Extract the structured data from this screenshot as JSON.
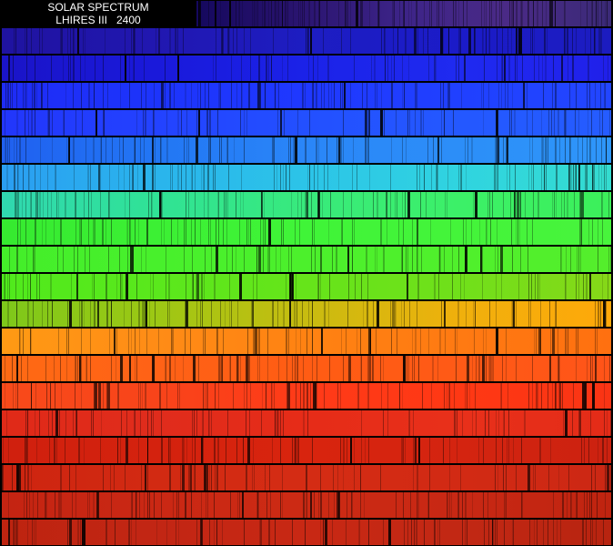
{
  "title": {
    "line1": "SOLAR SPECTRUM",
    "line2": "LHIRES III   2400"
  },
  "strips": [
    {
      "colors": [
        "#15085e",
        "#2a1470",
        "#3d2488",
        "#4a2a86",
        "#3b2a78"
      ]
    },
    {
      "colors": [
        "#1f13a0",
        "#2117b0",
        "#1d1dc2",
        "#1b1bc8",
        "#1c1cc0"
      ]
    },
    {
      "colors": [
        "#1a14c8",
        "#1a19da",
        "#1b22e8",
        "#1f2af0",
        "#2020ea"
      ]
    },
    {
      "colors": [
        "#1e2cf6",
        "#1d34fb",
        "#1f38ff",
        "#2040ff",
        "#2246ff"
      ]
    },
    {
      "colors": [
        "#2236fb",
        "#2342ff",
        "#2350ff",
        "#2458ff",
        "#255cff"
      ]
    },
    {
      "colors": [
        "#2060f0",
        "#2276f4",
        "#2a86f8",
        "#2c8ef8",
        "#2e96fa"
      ]
    },
    {
      "colors": [
        "#2a9ef2",
        "#2ab4ec",
        "#2cc4e8",
        "#30d4e0",
        "#34dcd0"
      ]
    },
    {
      "colors": [
        "#30d8b0",
        "#30e296",
        "#38ea7c",
        "#3cf068",
        "#3cf05a"
      ]
    },
    {
      "colors": [
        "#36ea30",
        "#3cf034",
        "#40f438",
        "#44f43a",
        "#48f43c"
      ]
    },
    {
      "colors": [
        "#44ee2a",
        "#48f02c",
        "#4cf02c",
        "#50f02c",
        "#54ee2c"
      ]
    },
    {
      "colors": [
        "#50ea1c",
        "#5ae81c",
        "#66e41a",
        "#70e01a",
        "#86d818"
      ]
    },
    {
      "colors": [
        "#7ec81a",
        "#9cc814",
        "#c8bc10",
        "#f0b00c",
        "#ffa80a"
      ]
    },
    {
      "colors": [
        "#ff9a14",
        "#ff8c16",
        "#ff8212",
        "#ff7a12",
        "#ff7010"
      ]
    },
    {
      "colors": [
        "#ff6a14",
        "#ff6216",
        "#ff5c14",
        "#ff5a16",
        "#ff5418"
      ]
    },
    {
      "colors": [
        "#f84a1a",
        "#f8441a",
        "#ff3a18",
        "#ff3814",
        "#fa3414"
      ]
    },
    {
      "colors": [
        "#e02a18",
        "#e02c1c",
        "#e62c18",
        "#e8301a",
        "#e42c18"
      ]
    },
    {
      "colors": [
        "#d0200e",
        "#d4220e",
        "#d8240e",
        "#d42410",
        "#cc2210"
      ]
    },
    {
      "colors": [
        "#ce2410",
        "#d22a12",
        "#d42c14",
        "#d22a14",
        "#cc2814"
      ]
    },
    {
      "colors": [
        "#c42412",
        "#ca2814",
        "#cc2a14",
        "#c82814",
        "#c02410"
      ]
    },
    {
      "colors": [
        "#be2410",
        "#c22614",
        "#c82814",
        "#c22814",
        "#b82410"
      ]
    }
  ]
}
